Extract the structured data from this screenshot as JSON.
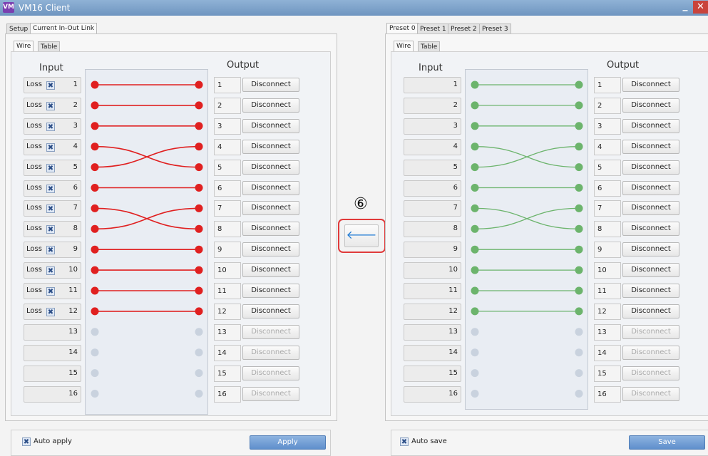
{
  "window": {
    "title": "VM16 Client",
    "app_icon": "VM",
    "minimize": "_",
    "close": "✕"
  },
  "colors": {
    "left_wire": "#e02020",
    "right_wire": "#6cb46c",
    "idle_dot": "#c9d2de"
  },
  "left": {
    "tabs": [
      "Setup",
      "Current In-Out Link"
    ],
    "subtabs": [
      "Wire",
      "Table"
    ],
    "input_header": "Input",
    "output_header": "Output",
    "rows": [
      {
        "in": "1",
        "loss": "Loss",
        "out": "1",
        "btn": "Disconnect",
        "connected": true
      },
      {
        "in": "2",
        "loss": "Loss",
        "out": "2",
        "btn": "Disconnect",
        "connected": true
      },
      {
        "in": "3",
        "loss": "Loss",
        "out": "3",
        "btn": "Disconnect",
        "connected": true
      },
      {
        "in": "4",
        "loss": "Loss",
        "out": "4",
        "btn": "Disconnect",
        "connected": true
      },
      {
        "in": "5",
        "loss": "Loss",
        "out": "5",
        "btn": "Disconnect",
        "connected": true
      },
      {
        "in": "6",
        "loss": "Loss",
        "out": "6",
        "btn": "Disconnect",
        "connected": true
      },
      {
        "in": "7",
        "loss": "Loss",
        "out": "7",
        "btn": "Disconnect",
        "connected": true
      },
      {
        "in": "8",
        "loss": "Loss",
        "out": "8",
        "btn": "Disconnect",
        "connected": true
      },
      {
        "in": "9",
        "loss": "Loss",
        "out": "9",
        "btn": "Disconnect",
        "connected": true
      },
      {
        "in": "10",
        "loss": "Loss",
        "out": "10",
        "btn": "Disconnect",
        "connected": true
      },
      {
        "in": "11",
        "loss": "Loss",
        "out": "11",
        "btn": "Disconnect",
        "connected": true
      },
      {
        "in": "12",
        "loss": "Loss",
        "out": "12",
        "btn": "Disconnect",
        "connected": true
      },
      {
        "in": "13",
        "loss": "",
        "out": "13",
        "btn": "Disconnect",
        "connected": false
      },
      {
        "in": "14",
        "loss": "",
        "out": "14",
        "btn": "Disconnect",
        "connected": false
      },
      {
        "in": "15",
        "loss": "",
        "out": "15",
        "btn": "Disconnect",
        "connected": false
      },
      {
        "in": "16",
        "loss": "",
        "out": "16",
        "btn": "Disconnect",
        "connected": false
      }
    ],
    "links": [
      [
        1,
        1
      ],
      [
        2,
        2
      ],
      [
        3,
        3
      ],
      [
        4,
        5
      ],
      [
        5,
        4
      ],
      [
        6,
        6
      ],
      [
        7,
        8
      ],
      [
        8,
        7
      ],
      [
        9,
        9
      ],
      [
        10,
        10
      ],
      [
        11,
        11
      ],
      [
        12,
        12
      ]
    ],
    "auto_label": "Auto apply",
    "action_label": "Apply"
  },
  "right": {
    "tabs": [
      "Preset 0",
      "Preset 1",
      "Preset 2",
      "Preset 3"
    ],
    "subtabs": [
      "Wire",
      "Table"
    ],
    "input_header": "Input",
    "output_header": "Output",
    "rows": [
      {
        "in": "1",
        "out": "1",
        "btn": "Disconnect",
        "connected": true
      },
      {
        "in": "2",
        "out": "2",
        "btn": "Disconnect",
        "connected": true
      },
      {
        "in": "3",
        "out": "3",
        "btn": "Disconnect",
        "connected": true
      },
      {
        "in": "4",
        "out": "4",
        "btn": "Disconnect",
        "connected": true
      },
      {
        "in": "5",
        "out": "5",
        "btn": "Disconnect",
        "connected": true
      },
      {
        "in": "6",
        "out": "6",
        "btn": "Disconnect",
        "connected": true
      },
      {
        "in": "7",
        "out": "7",
        "btn": "Disconnect",
        "connected": true
      },
      {
        "in": "8",
        "out": "8",
        "btn": "Disconnect",
        "connected": true
      },
      {
        "in": "9",
        "out": "9",
        "btn": "Disconnect",
        "connected": true
      },
      {
        "in": "10",
        "out": "10",
        "btn": "Disconnect",
        "connected": true
      },
      {
        "in": "11",
        "out": "11",
        "btn": "Disconnect",
        "connected": true
      },
      {
        "in": "12",
        "out": "12",
        "btn": "Disconnect",
        "connected": true
      },
      {
        "in": "13",
        "out": "13",
        "btn": "Disconnect",
        "connected": false
      },
      {
        "in": "14",
        "out": "14",
        "btn": "Disconnect",
        "connected": false
      },
      {
        "in": "15",
        "out": "15",
        "btn": "Disconnect",
        "connected": false
      },
      {
        "in": "16",
        "out": "16",
        "btn": "Disconnect",
        "connected": false
      }
    ],
    "links": [
      [
        1,
        1
      ],
      [
        2,
        2
      ],
      [
        3,
        3
      ],
      [
        4,
        5
      ],
      [
        5,
        4
      ],
      [
        6,
        6
      ],
      [
        7,
        8
      ],
      [
        8,
        7
      ],
      [
        9,
        9
      ],
      [
        10,
        10
      ],
      [
        11,
        11
      ],
      [
        12,
        12
      ]
    ],
    "auto_label": "Auto save",
    "action_label": "Save"
  },
  "center": {
    "marker": "⑥",
    "copy_icon": "🡐"
  }
}
